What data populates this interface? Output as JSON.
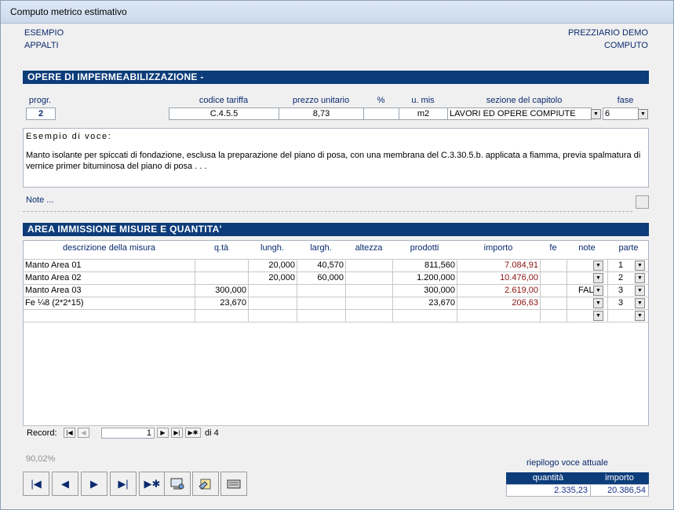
{
  "window": {
    "title": "Computo metrico estimativo"
  },
  "header": {
    "left_top": "ESEMPIO",
    "left_bottom": "APPALTI",
    "right_top": "PREZZIARIO DEMO",
    "right_bottom": "COMPUTO"
  },
  "section1": {
    "title": "OPERE DI IMPERMEABILIZZAZIONE -"
  },
  "fields": {
    "labels": {
      "progr": "progr.",
      "codice": "codice tariffa",
      "prezzo": "prezzo unitario",
      "perc": "%",
      "umis": "u. mis",
      "sezione": "sezione del capitolo",
      "fase": "fase"
    },
    "progr": "2",
    "codice": "C.4.5.5",
    "prezzo": "8,73",
    "perc": "",
    "umis": "m2",
    "sezione": "LAVORI ED OPERE COMPIUTE",
    "fase": "6"
  },
  "description": {
    "heading": "Esempio di voce:",
    "text": "Manto isolante per spiccati di fondazione, esclusa la preparazione del piano di posa, con una membrana del C.3.30.5.b. applicata a fiamma, previa spalmatura di vernice primer bituminosa del piano di posa . . ."
  },
  "note": {
    "label": "Note ..."
  },
  "section2": {
    "title": "AREA IMMISSIONE MISURE E QUANTITA'"
  },
  "grid": {
    "columns": [
      "descrizione della misura",
      "q.tà",
      "lungh.",
      "largh.",
      "altezza",
      "prodotti",
      "importo",
      "fe",
      "note",
      "parte"
    ],
    "rows": [
      {
        "desc": "Manto Area 01",
        "qta": "",
        "lungh": "20,000",
        "largh": "40,570",
        "altezza": "",
        "prodotti": "811,560",
        "importo": "7.084,91",
        "fe": "",
        "note": "",
        "parte": "1"
      },
      {
        "desc": "Manto Area 02",
        "qta": "",
        "lungh": "20,000",
        "largh": "60,000",
        "altezza": "",
        "prodotti": "1.200,000",
        "importo": "10.476,00",
        "fe": "",
        "note": "",
        "parte": "2"
      },
      {
        "desc": "Manto Area 03",
        "qta": "300,000",
        "lungh": "",
        "largh": "",
        "altezza": "",
        "prodotti": "300,000",
        "importo": "2.619,00",
        "fe": "",
        "note": "FAL",
        "parte": "3"
      },
      {
        "desc": "Fe ¼8 (2*2*15)",
        "qta": "23,670",
        "lungh": "",
        "largh": "",
        "altezza": "",
        "prodotti": "23,670",
        "importo": "206,63",
        "fe": "",
        "note": "",
        "parte": "3"
      }
    ]
  },
  "recordnav": {
    "label": "Record:",
    "current": "1",
    "of": "di 4"
  },
  "percent": "90,02%",
  "summary": {
    "title": "riepilogo voce attuale",
    "qta_label": "quantità",
    "importo_label": "importo",
    "qta": "2.335,23",
    "importo": "20.386,54"
  }
}
